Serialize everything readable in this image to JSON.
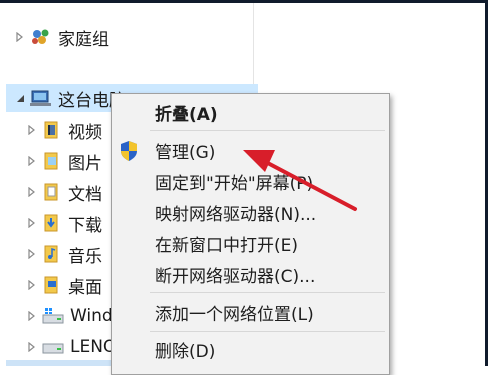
{
  "tree": {
    "homegroup": {
      "label": "家庭组",
      "icon": "homegroup-icon"
    },
    "this_pc": {
      "label": "这台电脑",
      "icon": "computer-icon",
      "expanded": true
    },
    "children": [
      {
        "label": "视频",
        "icon": "videos-folder-icon"
      },
      {
        "label": "图片",
        "icon": "pictures-folder-icon"
      },
      {
        "label": "文档",
        "icon": "documents-folder-icon"
      },
      {
        "label": "下载",
        "icon": "downloads-folder-icon"
      },
      {
        "label": "音乐",
        "icon": "music-folder-icon"
      },
      {
        "label": "桌面",
        "icon": "desktop-folder-icon"
      },
      {
        "label": "Windows",
        "icon": "windows-drive-icon"
      },
      {
        "label": "LENOVO",
        "icon": "drive-icon"
      }
    ]
  },
  "context_menu": {
    "items": [
      {
        "label": "折叠(A)",
        "bold": true
      },
      {
        "label": "管理(G)",
        "icon": "uac-shield-icon"
      },
      {
        "label": "固定到\"开始\"屏幕(P)"
      },
      {
        "label": "映射网络驱动器(N)..."
      },
      {
        "label": "在新窗口中打开(E)"
      },
      {
        "label": "断开网络驱动器(C)..."
      },
      {
        "label": "添加一个网络位置(L)"
      },
      {
        "label": "删除(D)"
      }
    ]
  },
  "annotation": {
    "color": "#d81e2a",
    "points_to": "管理(G)"
  },
  "colors": {
    "selection": "#cce8ff",
    "menu_bg": "#f2f2f2",
    "frame": "#101b2c"
  }
}
